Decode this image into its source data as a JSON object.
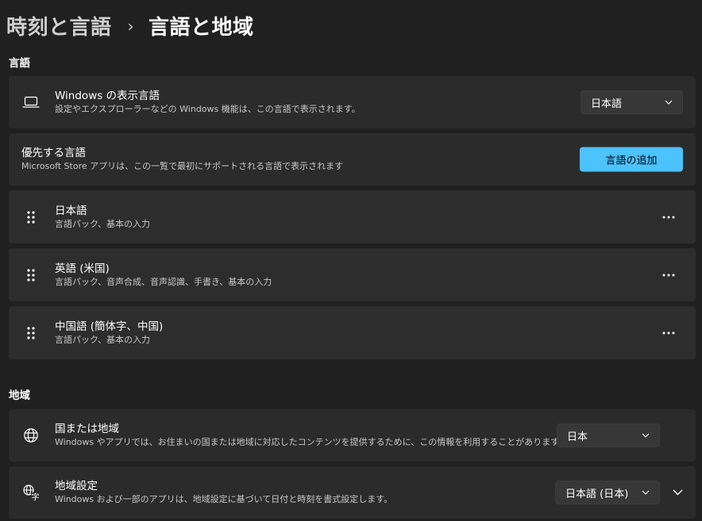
{
  "breadcrumb": {
    "parent": "時刻と言語",
    "separator": "›",
    "current": "言語と地域"
  },
  "sections": {
    "language": "言語",
    "region": "地域"
  },
  "display_language": {
    "title": "Windows の表示言語",
    "subtitle": "設定やエクスプローラーなどの Windows 機能は、この言語で表示されます。",
    "value": "日本語",
    "icon": "laptop-icon"
  },
  "preferred": {
    "title": "優先する言語",
    "subtitle": "Microsoft Store アプリは、この一覧で最初にサポートされる言語で表示されます",
    "add_button": "言語の追加"
  },
  "languages": [
    {
      "name": "日本語",
      "features": "言語パック、基本の入力"
    },
    {
      "name": "英語 (米国)",
      "features": "言語パック、音声合成、音声認識、手書き、基本の入力"
    },
    {
      "name": "中国語 (簡体字、中国)",
      "features": "言語パック、基本の入力"
    }
  ],
  "country": {
    "title": "国または地域",
    "subtitle": "Windows やアプリでは、お住まいの国または地域に対応したコンテンツを提供するために、この情報を利用することがあります",
    "value": "日本",
    "icon": "globe-icon"
  },
  "regional_format": {
    "title": "地域設定",
    "subtitle": "Windows および一部のアプリは、地域設定に基づいて日付と時刻を書式設定します。",
    "value": "日本語 (日本)",
    "icon": "regional-format-icon"
  },
  "colors": {
    "background": "#202020",
    "card": "#2b2b2b",
    "accent": "#4cc2ff"
  }
}
